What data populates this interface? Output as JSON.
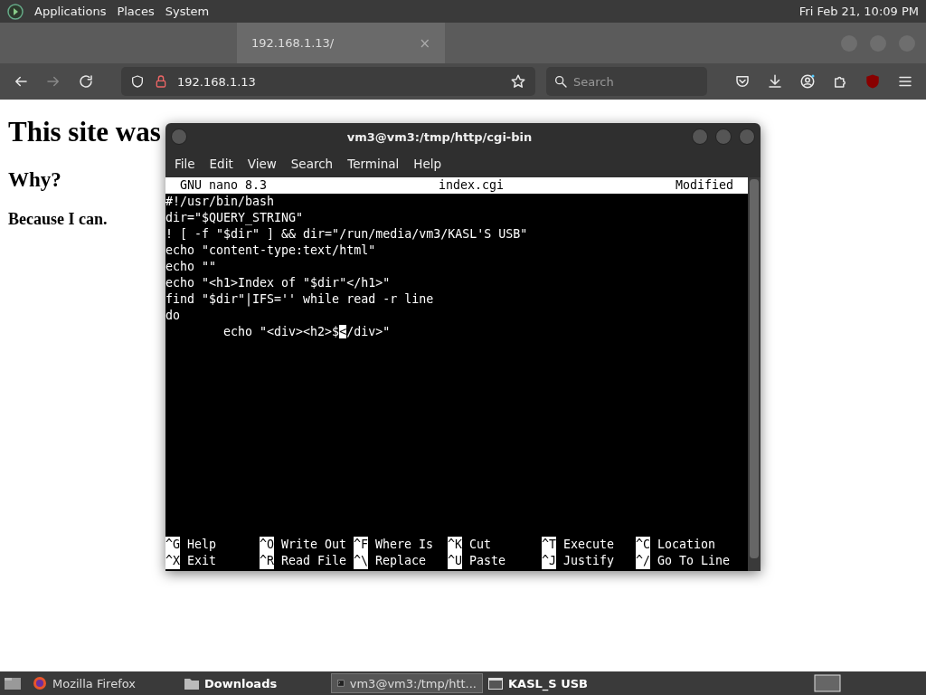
{
  "top_panel": {
    "menus": [
      "Applications",
      "Places",
      "System"
    ],
    "clock": "Fri Feb 21, 10:09 PM"
  },
  "browser": {
    "tabs": [
      {
        "label": "192.168.1.13/",
        "close": "×",
        "selected": true
      }
    ],
    "url": "192.168.1.13",
    "search": {
      "placeholder": "Search"
    },
    "page": {
      "heading": "This site was",
      "subheading": "Why?",
      "text": "Because I can."
    }
  },
  "terminal": {
    "title": "vm3@vm3:/tmp/http/cgi-bin",
    "menu": [
      "File",
      "Edit",
      "View",
      "Search",
      "Terminal",
      "Help"
    ],
    "nano": {
      "version": "GNU nano 8.3",
      "file": "index.cgi",
      "status": "Modified",
      "lines": [
        {
          "text": "#!/usr/bin/bash"
        },
        {
          "text": "dir=\"$QUERY_STRING\""
        },
        {
          "text": "! [ -f \"$dir\" ] && dir=\"/run/media/vm3/KASL'S USB\""
        },
        {
          "text": "echo \"content-type:text/html\""
        },
        {
          "text": "echo \"\""
        },
        {
          "text": "echo \"<h1>Index of \"$dir\"</h1>\""
        },
        {
          "text": "find \"$dir\"|IFS='' while read -r line"
        },
        {
          "text": "do"
        },
        {
          "text": "        echo \"<div><h2>$",
          "cursor": "<",
          "rest": "/div>\""
        }
      ],
      "shortcuts": [
        [
          {
            "key": "^G",
            "label": "Help"
          },
          {
            "key": "^O",
            "label": "Write Out"
          },
          {
            "key": "^F",
            "label": "Where Is"
          },
          {
            "key": "^K",
            "label": "Cut"
          },
          {
            "key": "^T",
            "label": "Execute"
          },
          {
            "key": "^C",
            "label": "Location"
          }
        ],
        [
          {
            "key": "^X",
            "label": "Exit"
          },
          {
            "key": "^R",
            "label": "Read File"
          },
          {
            "key": "^\\",
            "label": "Replace"
          },
          {
            "key": "^U",
            "label": "Paste"
          },
          {
            "key": "^J",
            "label": "Justify"
          },
          {
            "key": "^/",
            "label": "Go To Line"
          }
        ]
      ]
    }
  },
  "taskbar": {
    "items": [
      {
        "kind": "browser",
        "label": "Mozilla Firefox",
        "selected": false,
        "attention": false
      },
      {
        "kind": "folder",
        "label": "Downloads",
        "selected": false,
        "attention": true
      },
      {
        "kind": "terminal",
        "label": "vm3@vm3:/tmp/htt...",
        "selected": true,
        "attention": false
      },
      {
        "kind": "drive",
        "label": "KASL_S USB",
        "selected": false,
        "attention": true
      }
    ]
  }
}
